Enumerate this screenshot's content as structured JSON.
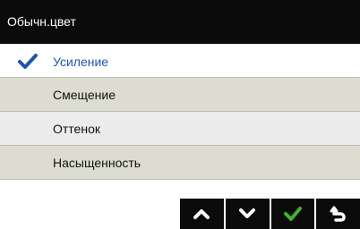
{
  "header": {
    "title": "Обычн.цвет"
  },
  "menu": {
    "items": [
      {
        "label": "Усиление",
        "selected": true
      },
      {
        "label": "Смещение",
        "selected": false
      },
      {
        "label": "Оттенок",
        "selected": false
      },
      {
        "label": "Насыщенность",
        "selected": false
      }
    ]
  },
  "toolbar": {
    "buttons": [
      {
        "icon": "chevron-up-icon"
      },
      {
        "icon": "chevron-down-icon"
      },
      {
        "icon": "checkmark-icon"
      },
      {
        "icon": "return-icon"
      }
    ]
  },
  "colors": {
    "header_bg": "#0b0b0b",
    "selected_text": "#1f56a8",
    "check_blue": "#1f56a8",
    "ok_green": "#45b02f",
    "row_alt_bg": "#dcdcd0",
    "row_bg": "#ececec"
  }
}
